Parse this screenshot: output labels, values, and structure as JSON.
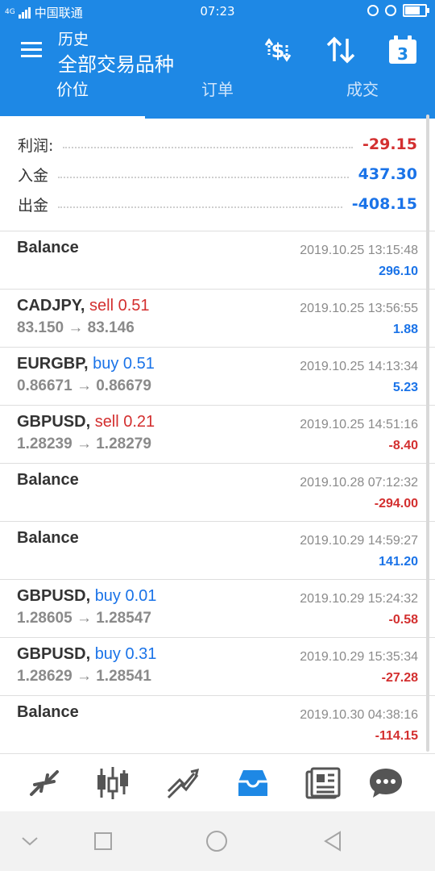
{
  "status_bar": {
    "signal": "4G",
    "carrier": "中国联通",
    "time": "07:23"
  },
  "header": {
    "title": "历史",
    "subtitle": "全部交易品种",
    "calendar_day": "3"
  },
  "tabs": [
    {
      "label": "价位",
      "active": true
    },
    {
      "label": "订单",
      "active": false
    },
    {
      "label": "成交",
      "active": false
    }
  ],
  "summary": [
    {
      "label": "利润:",
      "value": "-29.15",
      "sign": "neg"
    },
    {
      "label": "入金",
      "value": "437.30",
      "sign": "pos"
    },
    {
      "label": "出金",
      "value": "-408.15",
      "sign": "pos"
    }
  ],
  "deals": [
    {
      "symbol": "Balance",
      "action": "",
      "prices": "",
      "time": "2019.10.25 13:15:48",
      "profit": "296.10",
      "profit_sign": "pos"
    },
    {
      "symbol": "CADJPY,",
      "action": "sell 0.51",
      "action_type": "sell",
      "prices": "83.150 → 83.146",
      "time": "2019.10.25 13:56:55",
      "profit": "1.88",
      "profit_sign": "pos"
    },
    {
      "symbol": "EURGBP,",
      "action": "buy 0.51",
      "action_type": "buy",
      "prices": "0.86671 → 0.86679",
      "time": "2019.10.25 14:13:34",
      "profit": "5.23",
      "profit_sign": "pos"
    },
    {
      "symbol": "GBPUSD,",
      "action": "sell 0.21",
      "action_type": "sell",
      "prices": "1.28239 → 1.28279",
      "time": "2019.10.25 14:51:16",
      "profit": "-8.40",
      "profit_sign": "neg"
    },
    {
      "symbol": "Balance",
      "action": "",
      "prices": "",
      "time": "2019.10.28 07:12:32",
      "profit": "-294.00",
      "profit_sign": "neg"
    },
    {
      "symbol": "Balance",
      "action": "",
      "prices": "",
      "time": "2019.10.29 14:59:27",
      "profit": "141.20",
      "profit_sign": "pos"
    },
    {
      "symbol": "GBPUSD,",
      "action": "buy 0.01",
      "action_type": "buy",
      "prices": "1.28605 → 1.28547",
      "time": "2019.10.29 15:24:32",
      "profit": "-0.58",
      "profit_sign": "neg"
    },
    {
      "symbol": "GBPUSD,",
      "action": "buy 0.31",
      "action_type": "buy",
      "prices": "1.28629 → 1.28541",
      "time": "2019.10.29 15:35:34",
      "profit": "-27.28",
      "profit_sign": "neg"
    },
    {
      "symbol": "Balance",
      "action": "",
      "prices": "",
      "time": "2019.10.30 04:38:16",
      "profit": "-114.15",
      "profit_sign": "neg"
    }
  ],
  "bottom_nav": [
    {
      "icon": "quotes-icon",
      "active": false
    },
    {
      "icon": "candlestick-chart-icon",
      "active": false
    },
    {
      "icon": "trade-icon",
      "active": false
    },
    {
      "icon": "history-inbox-icon",
      "active": true
    },
    {
      "icon": "news-icon",
      "active": false
    },
    {
      "icon": "chat-icon",
      "active": false
    }
  ],
  "colors": {
    "primary": "#1e88e5",
    "positive": "#1a73e8",
    "negative": "#d32f2f",
    "sell": "#d32f2f",
    "buy": "#1a73e8"
  }
}
